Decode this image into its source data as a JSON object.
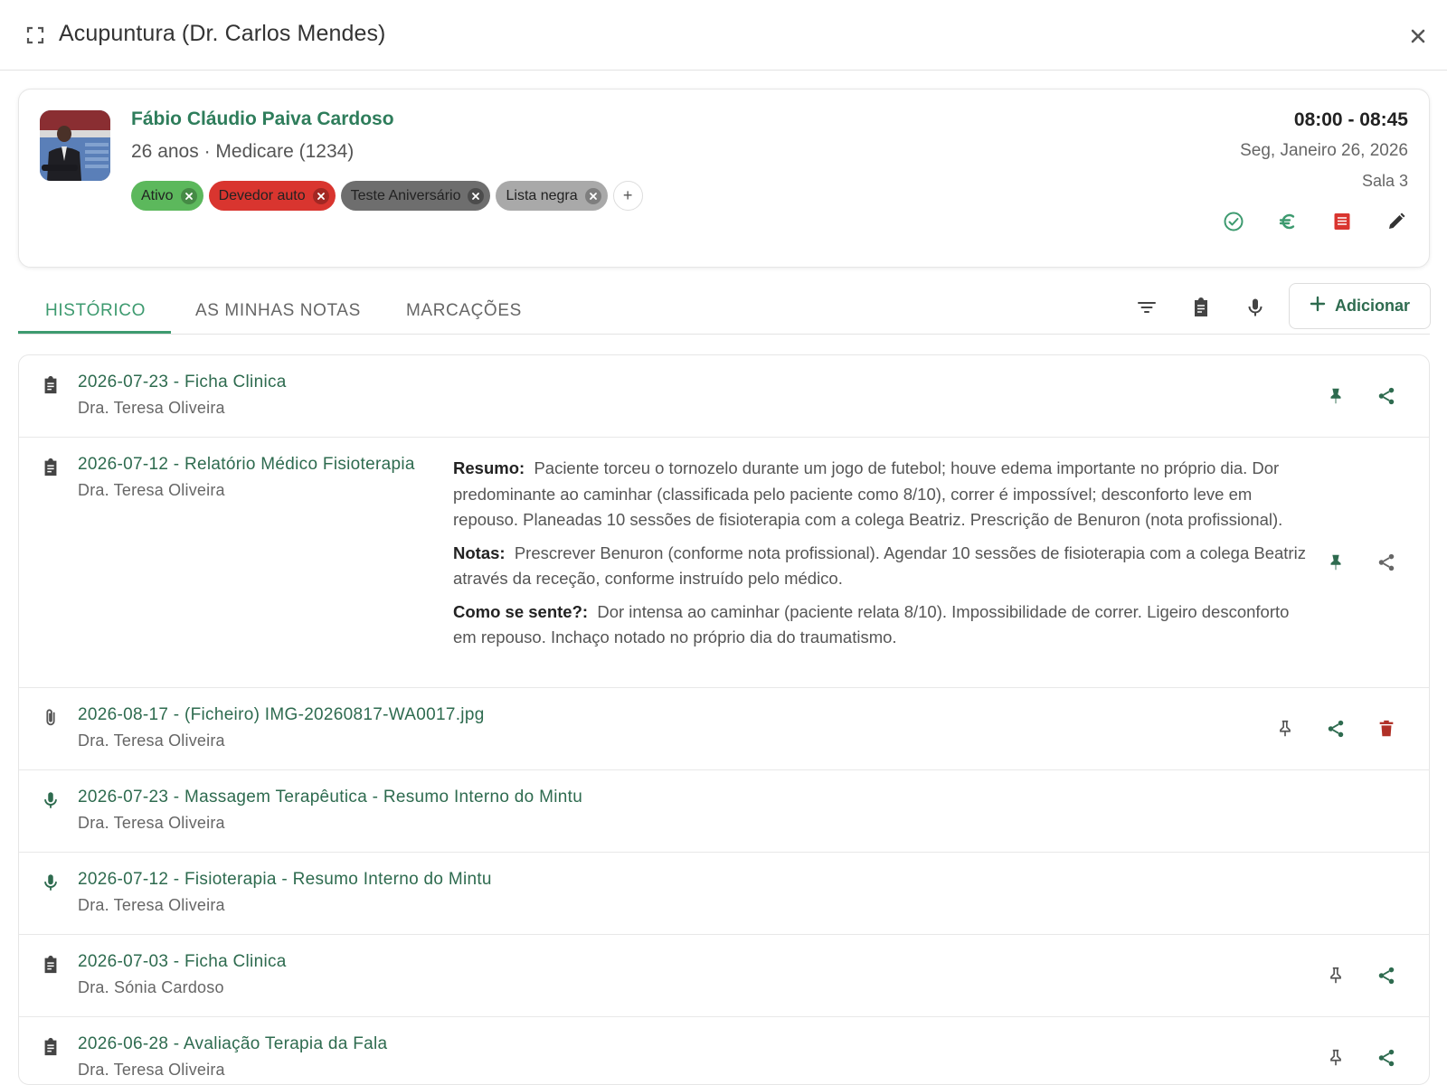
{
  "header": {
    "title": "Acupuntura (Dr. Carlos Mendes)"
  },
  "patient": {
    "name": "Fábio Cláudio Paiva Cardoso",
    "meta": "26 anos · Medicare (1234)",
    "tags": [
      {
        "label": "Ativo",
        "color": "#5cb85c"
      },
      {
        "label": "Devedor auto",
        "color": "#d9352f"
      },
      {
        "label": "Teste Aniversário",
        "color": "#6e6e6e"
      },
      {
        "label": "Lista negra",
        "color": "#a9a9a9"
      }
    ],
    "time": "08:00 - 08:45",
    "date": "Seg, Janeiro 26, 2026",
    "room": "Sala 3"
  },
  "tabs": [
    {
      "label": "HISTÓRICO",
      "active": true
    },
    {
      "label": "AS MINHAS NOTAS",
      "active": false
    },
    {
      "label": "MARCAÇÕES",
      "active": false
    }
  ],
  "toolbar": {
    "add_label": "Adicionar"
  },
  "records": [
    {
      "title": "2026-07-23 - Ficha Clinica",
      "author": "Dra. Teresa Oliveira",
      "icon": "clipboard-icon",
      "pinned": true
    },
    {
      "title": "2026-07-12 - Relatório Médico Fisioterapia",
      "author": "Dra. Teresa Oliveira",
      "icon": "clipboard-icon",
      "pinned": true,
      "summary": [
        {
          "label": "Resumo:",
          "text": "Paciente torceu o tornozelo durante um jogo de futebol; houve edema importante no próprio dia. Dor predominante ao caminhar (classificada pelo paciente como 8/10), correr é impossível; desconforto leve em repouso. Planeadas 10 sessões de fisioterapia com a colega Beatriz. Prescrição de Benuron (nota profissional)."
        },
        {
          "label": "Notas:",
          "text": "Prescrever Benuron (conforme nota profissional). Agendar 10 sessões de fisioterapia com a colega Beatriz através da receção, conforme instruído pelo médico."
        },
        {
          "label": "Como se sente?:",
          "text": "Dor intensa ao caminhar (paciente relata 8/10). Impossibilidade de correr. Ligeiro desconforto em repouso. Inchaço notado no próprio dia do traumatismo."
        }
      ]
    },
    {
      "title": "2026-08-17 - (Ficheiro) IMG-20260817-WA0017.jpg",
      "author": "Dra. Teresa Oliveira",
      "icon": "paperclip-icon",
      "pinned": false
    },
    {
      "title": "2026-07-23 - Massagem Terapêutica - Resumo Interno do Mintu",
      "author": "Dra. Teresa Oliveira",
      "icon": "microphone-icon"
    },
    {
      "title": "2026-07-12 - Fisioterapia - Resumo Interno do Mintu",
      "author": "Dra. Teresa Oliveira",
      "icon": "microphone-icon"
    },
    {
      "title": "2026-07-03 - Ficha Clinica",
      "author": "Dra. Sónia Cardoso",
      "icon": "clipboard-icon",
      "pinned": false
    },
    {
      "title": "2026-06-28 - Avaliação Terapia da Fala",
      "author": "Dra. Teresa Oliveira",
      "icon": "clipboard-icon",
      "pinned": false
    }
  ],
  "colors": {
    "accent": "#3d9a6f",
    "link": "#2e6b4f",
    "danger": "#c0392b"
  }
}
